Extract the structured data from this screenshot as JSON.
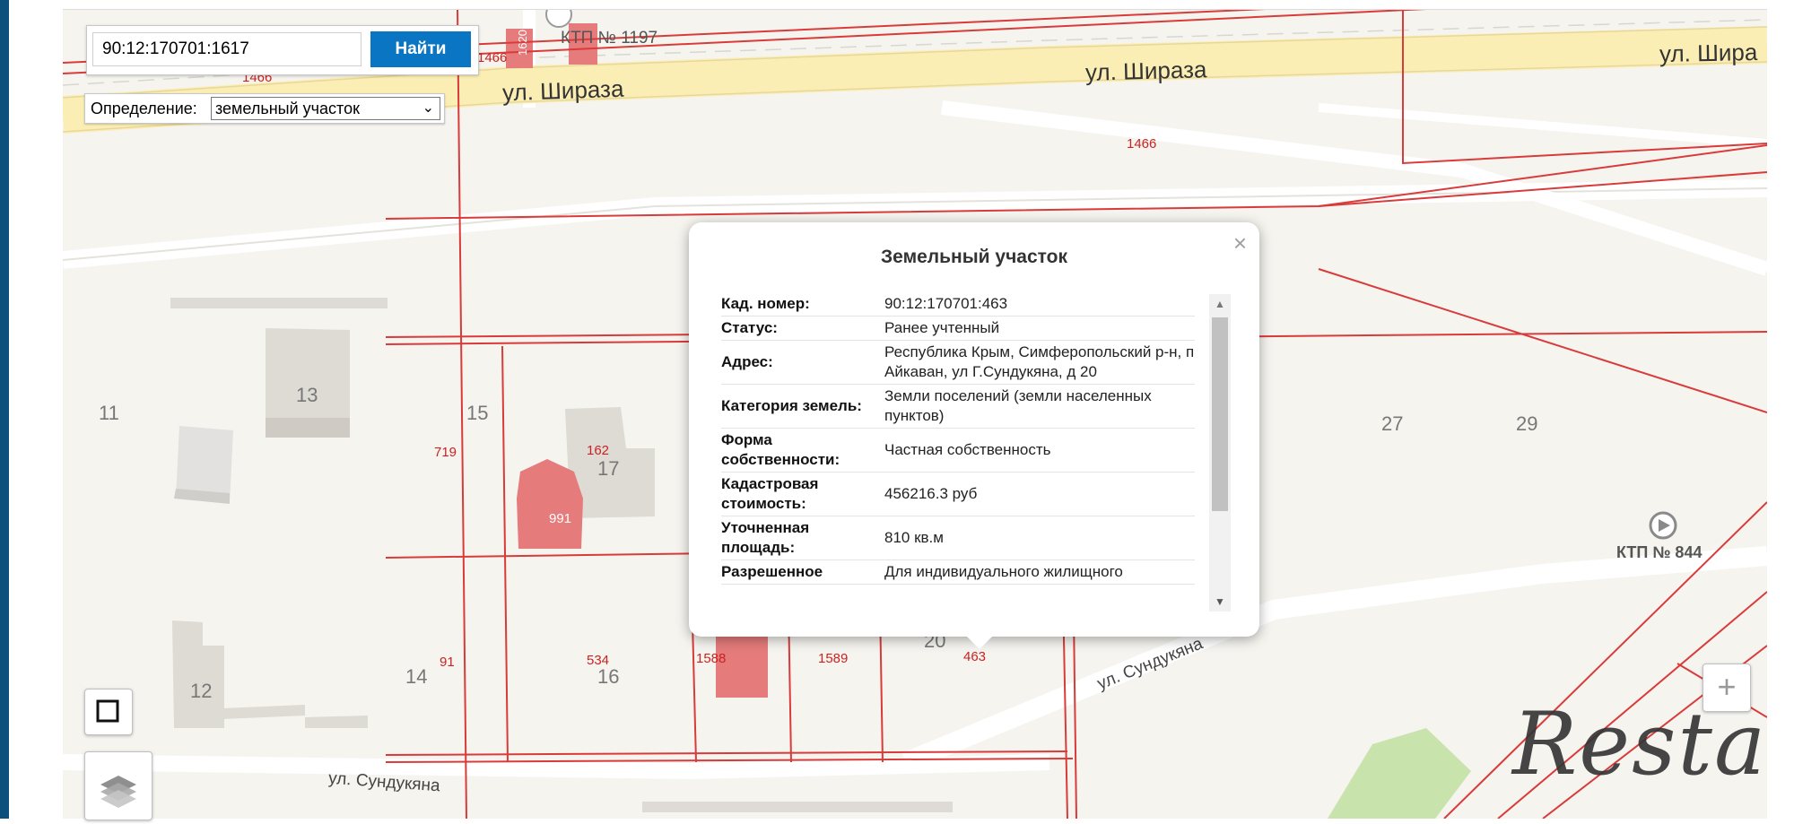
{
  "search": {
    "value": "90:12:170701:1617",
    "button_label": "Найти"
  },
  "definition": {
    "label": "Определение:",
    "selected": "земельный участок"
  },
  "map": {
    "streets": [
      "ул. Шираза",
      "ул. Шираза",
      "ул. Шира",
      "ул. Сундукяна",
      "ул. Сундукяна"
    ],
    "house_numbers": [
      "11",
      "13",
      "15",
      "17",
      "14",
      "16",
      "12",
      "27",
      "29",
      "20"
    ],
    "parcel_labels": [
      "1466",
      "1466",
      "1466",
      "719",
      "162",
      "991",
      "91",
      "534",
      "1588",
      "1589",
      "463",
      "1620"
    ],
    "ktp_labels": [
      "КТП № 1197",
      "КТП № 844"
    ],
    "zoom_in_label": "+"
  },
  "popup": {
    "title": "Земельный участок",
    "close": "×",
    "rows": [
      {
        "key": "Кад. номер:",
        "value": "90:12:170701:463"
      },
      {
        "key": "Статус:",
        "value": "Ранее учтенный"
      },
      {
        "key": "Адрес:",
        "value": "Республика Крым, Симферопольский р-н, п Айкаван, ул Г.Сундукяна, д 20"
      },
      {
        "key": "Категория земель:",
        "value": "Земли поселений (земли населенных пунктов)"
      },
      {
        "key": "Форма собственности:",
        "value": "Частная собственность"
      },
      {
        "key": "Кадастровая стоимость:",
        "value": "456216.3 руб"
      },
      {
        "key": "Уточненная площадь:",
        "value": "810 кв.м"
      },
      {
        "key": "Разрешенное",
        "value": "Для индивидуального жилищного"
      }
    ],
    "scroll_up": "▲",
    "scroll_down": "▼"
  },
  "watermark": "Restate",
  "colors": {
    "parcel_line": "#d93b3b",
    "road": "#fbeeb5",
    "button": "#0a75c2",
    "building": "#dedad4",
    "parcel_fill": "#e57b7b",
    "park": "#c9e3ad"
  }
}
